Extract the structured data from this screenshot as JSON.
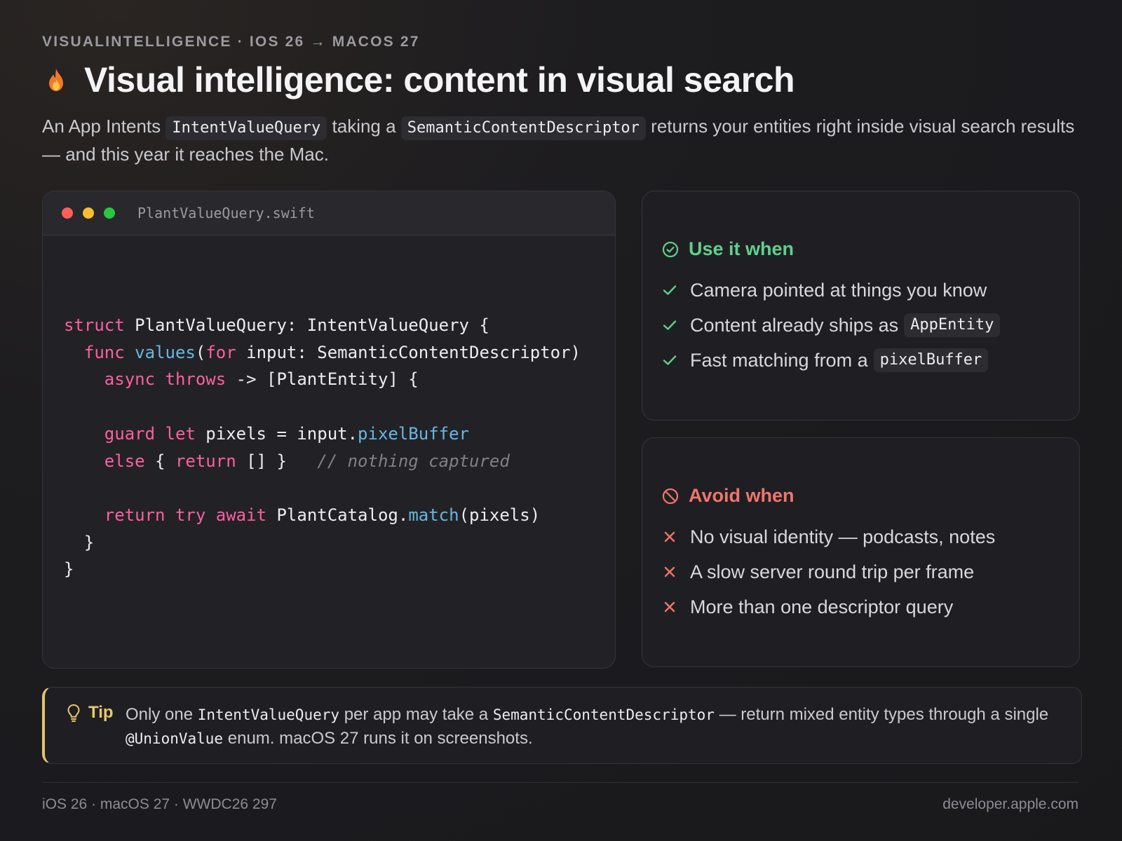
{
  "header": {
    "eyebrow": "VISUALINTELLIGENCE · IOS 26 → MACOS 27",
    "icon": "flame-icon",
    "title": "Visual intelligence: content in visual search",
    "lede": {
      "p1": "An App Intents ",
      "code1": "IntentValueQuery",
      "p2": " taking a ",
      "code2": "SemanticContentDescriptor",
      "p3": " returns your entities right inside visual search results — and this year it reaches the Mac."
    }
  },
  "code_window": {
    "filename": "PlantValueQuery.swift",
    "lines": {
      "l1_kw": "struct",
      "l1_rest": " PlantValueQuery: IntentValueQuery {",
      "l2_indent": "  ",
      "l2_kw": "func",
      "l2_sp": " ",
      "l2_fn": "values",
      "l2_paren": "(",
      "l2_kw2": "for",
      "l2_rest": " input: SemanticContentDescriptor)",
      "l3_indent": "    ",
      "l3_kw": "async",
      "l3_sp": " ",
      "l3_kw2": "throws",
      "l3_rest": " -> [PlantEntity] {",
      "l5_indent": "    ",
      "l5_kw": "guard",
      "l5_sp": " ",
      "l5_kw2": "let",
      "l5_rest": " pixels = input.",
      "l5_fn": "pixelBuffer",
      "l6_indent": "    ",
      "l6_kw": "else",
      "l6_mid": " { ",
      "l6_kw2": "return",
      "l6_rest": " [] }   ",
      "l6_cm": "// nothing captured",
      "l8_indent": "    ",
      "l8_kw": "return",
      "l8_sp": " ",
      "l8_kw2": "try",
      "l8_sp2": " ",
      "l8_kw3": "await",
      "l8_rest": " PlantCatalog.",
      "l8_fn": "match",
      "l8_end": "(pixels)",
      "l9": "  }",
      "l10": "}"
    }
  },
  "use_card": {
    "title": "Use it when",
    "items": [
      {
        "text": "Camera pointed at things you know",
        "code": ""
      },
      {
        "text": "Content already ships as",
        "code": "AppEntity"
      },
      {
        "text": "Fast matching from a",
        "code": "pixelBuffer"
      }
    ]
  },
  "avoid_card": {
    "title": "Avoid when",
    "items": [
      {
        "text": "No visual identity — podcasts, notes"
      },
      {
        "text": "A slow server round trip per frame"
      },
      {
        "text": "More than one descriptor query"
      }
    ]
  },
  "tip": {
    "label": "Tip",
    "t1": "Only one ",
    "c1": "IntentValueQuery",
    "t2": " per app may take a ",
    "c2": "SemanticContentDescriptor",
    "t3": " — return mixed entity types through a single ",
    "c3": "@UnionValue",
    "t4": " enum. macOS 27 runs it on screenshots."
  },
  "footer": {
    "left": "iOS 26 · macOS 27 · WWDC26 297",
    "right": "developer.apple.com"
  },
  "colors": {
    "use_accent": "#5fd08a",
    "avoid_accent": "#f0756a",
    "tip_accent": "#e3c46d",
    "keyword": "#fc5fa3",
    "function": "#67b7e1"
  }
}
